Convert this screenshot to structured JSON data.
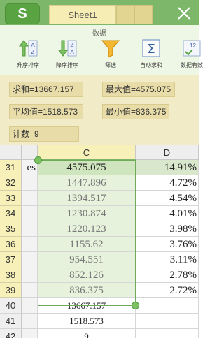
{
  "topbar": {
    "app_letter": "S",
    "sheet_tab": "Sheet1"
  },
  "ribbon": {
    "title": "数据",
    "tools": [
      {
        "label": "升序排序",
        "icon": "sort-ascending-icon"
      },
      {
        "label": "降序排序",
        "icon": "sort-descending-icon"
      },
      {
        "label": "筛选",
        "icon": "filter-icon"
      },
      {
        "label": "自动求和",
        "icon": "autosum-icon"
      },
      {
        "label": "数据有效",
        "icon": "data-validation-icon"
      }
    ]
  },
  "stats": {
    "sum": "求和=13667.157",
    "max": "最大值=4575.075",
    "avg": "平均值=1518.573",
    "min": "最小值=836.375",
    "count": "计数=9"
  },
  "grid": {
    "col_c": "C",
    "col_d": "D",
    "rows": [
      {
        "num": "31",
        "b": "es",
        "c": "4575.075",
        "d": "14.91%"
      },
      {
        "num": "32",
        "b": "",
        "c": "1447.896",
        "d": "4.72%"
      },
      {
        "num": "33",
        "b": "",
        "c": "1394.517",
        "d": "4.54%"
      },
      {
        "num": "34",
        "b": "",
        "c": "1230.874",
        "d": "4.01%"
      },
      {
        "num": "35",
        "b": "",
        "c": "1220.123",
        "d": "3.98%"
      },
      {
        "num": "36",
        "b": "",
        "c": "1155.62",
        "d": "3.76%"
      },
      {
        "num": "37",
        "b": "",
        "c": "954.551",
        "d": "3.11%"
      },
      {
        "num": "38",
        "b": "",
        "c": "852.126",
        "d": "2.78%"
      },
      {
        "num": "39",
        "b": "",
        "c": "836.375",
        "d": "2.72%"
      },
      {
        "num": "40",
        "b": "",
        "c": "13667.157",
        "d": ""
      },
      {
        "num": "41",
        "b": "",
        "c": "1518.573",
        "d": ""
      },
      {
        "num": "42",
        "b": "",
        "c": "9",
        "d": ""
      }
    ]
  },
  "colors": {
    "accent": "#7db86a",
    "selection_border": "#6faa58"
  }
}
